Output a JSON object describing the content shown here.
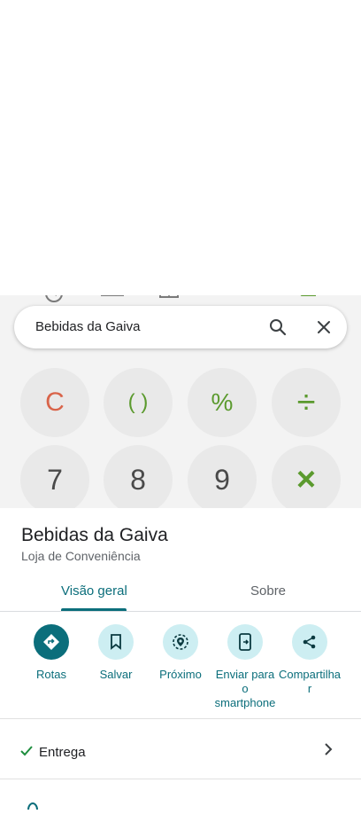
{
  "calculator": {
    "keys": [
      {
        "label": "C",
        "color": "#d9644a"
      },
      {
        "label": "( )",
        "color": "#5b9a2e"
      },
      {
        "label": "%",
        "color": "#5b9a2e"
      },
      {
        "label": "÷",
        "color": "#5b9a2e"
      },
      {
        "label": "7",
        "color": "#4a4a4a"
      },
      {
        "label": "8",
        "color": "#4a4a4a"
      },
      {
        "label": "9",
        "color": "#4a4a4a"
      },
      {
        "label": "×",
        "color": "#5b9a2e"
      }
    ]
  },
  "search": {
    "query": "Bebidas da Gaiva"
  },
  "place": {
    "name": "Bebidas da Gaiva",
    "category": "Loja de Conveniência"
  },
  "tabs": [
    {
      "label": "Visão geral",
      "active": true
    },
    {
      "label": "Sobre",
      "active": false
    }
  ],
  "actions": [
    {
      "label": "Rotas",
      "icon": "directions-icon"
    },
    {
      "label": "Salvar",
      "icon": "bookmark-icon"
    },
    {
      "label": "Próximo",
      "icon": "nearby-icon"
    },
    {
      "label": "Enviar para o smartphone",
      "icon": "send-to-phone-icon"
    },
    {
      "label": "Compartilhar",
      "icon": "share-icon"
    }
  ],
  "info": {
    "delivery": "Entrega"
  },
  "colors": {
    "accent": "#0b6e7b",
    "accent_light": "#cdeef2"
  }
}
